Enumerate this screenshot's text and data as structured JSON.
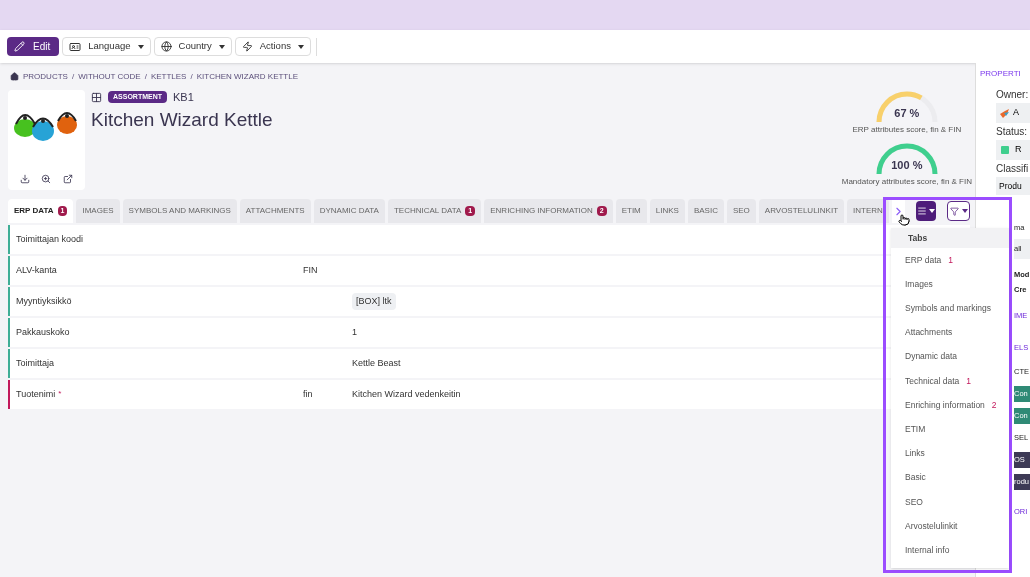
{
  "toolbar": {
    "buttons": [
      {
        "label": "Edit",
        "kind": "primary"
      },
      {
        "label": "Language",
        "kind": "language"
      },
      {
        "label": "Country",
        "kind": "country"
      },
      {
        "label": "Actions",
        "kind": "actions"
      }
    ]
  },
  "breadcrumb": {
    "items": [
      "PRODUCTS",
      "WITHOUT CODE",
      "KETTLES",
      "KITCHEN WIZARD KETTLE"
    ],
    "separator": "/"
  },
  "product": {
    "badge": "ASSORTMENT",
    "code": "KB1",
    "title": "Kitchen Wizard Kettle"
  },
  "scores": [
    {
      "value": "67 %",
      "label": "ERP attributes score, fin & FIN",
      "color": "#f8d06b"
    },
    {
      "value": "100 %",
      "label": "Mandatory attributes score, fin & FIN",
      "color": "#3fcf8e"
    }
  ],
  "tabs": [
    {
      "label": "ERP DATA",
      "badge": "1",
      "selected": true
    },
    {
      "label": "IMAGES",
      "selected": false
    },
    {
      "label": "SYMBOLS AND MARKINGS",
      "selected": false
    },
    {
      "label": "ATTACHMENTS",
      "selected": false
    },
    {
      "label": "DYNAMIC DATA",
      "selected": false
    },
    {
      "label": "TECHNICAL DATA",
      "badge": "1",
      "selected": false
    },
    {
      "label": "ENRICHING INFORMATION",
      "badge": "2",
      "selected": false
    },
    {
      "label": "ETIM",
      "selected": false
    },
    {
      "label": "LINKS",
      "selected": false
    },
    {
      "label": "BASIC",
      "selected": false
    },
    {
      "label": "SEO",
      "selected": false
    },
    {
      "label": "ARVOSTELULINKIT",
      "selected": false
    },
    {
      "label": "INTERN",
      "selected": false
    }
  ],
  "table": {
    "required_mark": "*",
    "rows": [
      {
        "label": "Toimittajan koodi",
        "required": false
      },
      {
        "label": "ALV-kanta",
        "required": false,
        "lang": "FIN"
      },
      {
        "label": "Myyntiyksikkö",
        "required": false,
        "value": "[BOX] ltk",
        "kind": "tag"
      },
      {
        "label": "Pakkauskoko",
        "required": false,
        "value": "1",
        "kind": "text"
      },
      {
        "label": "Toimittaja",
        "required": false,
        "value": "Kettle Beast",
        "kind": "text"
      },
      {
        "label": "Tuotenimi",
        "required": true,
        "lang": "fin",
        "value": "Kitchen Wizard vedenkeitin",
        "kind": "text"
      }
    ]
  },
  "tabs_menu": {
    "title": "Tabs",
    "items": [
      {
        "label": "ERP data",
        "count": "1"
      },
      {
        "label": "Images"
      },
      {
        "label": "Symbols and markings"
      },
      {
        "label": "Attachments"
      },
      {
        "label": "Dynamic data"
      },
      {
        "label": "Technical data",
        "count": "1"
      },
      {
        "label": "Enriching information",
        "count": "2"
      },
      {
        "label": "ETIM"
      },
      {
        "label": "Links"
      },
      {
        "label": "Basic"
      },
      {
        "label": "SEO"
      },
      {
        "label": "Arvostelulinkit"
      },
      {
        "label": "Internal info"
      }
    ]
  },
  "right_panel": {
    "title": "PROPERTI",
    "owner_label": "Owner:",
    "owner_value": "A",
    "status_label": "Status:",
    "status_value": "R",
    "classification_label": "Classifi",
    "classification_value": "Produ",
    "fragments": [
      {
        "text": "ma",
        "kind": "text"
      },
      {
        "text": "all",
        "kind": "field"
      },
      {
        "text": "Mod",
        "kind": "bold"
      },
      {
        "text": "Cre",
        "kind": "bold"
      },
      {
        "text": "IME",
        "kind": "heading"
      },
      {
        "text": "ELS",
        "kind": "heading"
      },
      {
        "text": "CTE",
        "kind": "text"
      },
      {
        "text": "Con",
        "kind": "tag"
      },
      {
        "text": "Con",
        "kind": "tag"
      },
      {
        "text": "SEL",
        "kind": "text"
      },
      {
        "text": "OS",
        "kind": "dark-tag"
      },
      {
        "text": "rodu",
        "kind": "dark-tag"
      },
      {
        "text": "ORI",
        "kind": "heading"
      }
    ]
  }
}
